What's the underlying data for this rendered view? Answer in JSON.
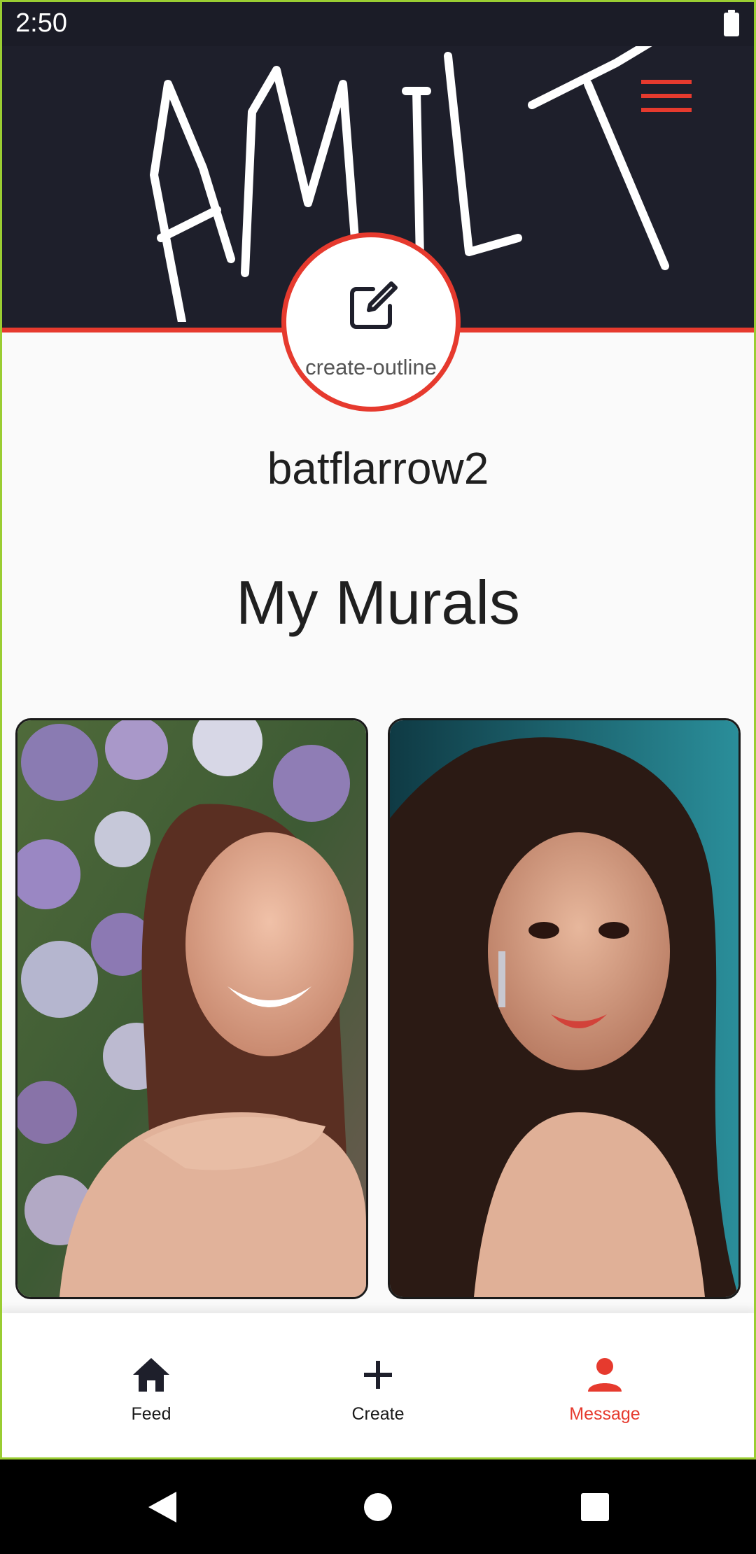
{
  "status_bar": {
    "time": "2:50",
    "battery_icon": "battery-full-icon"
  },
  "header": {
    "signature_text": "AMIT",
    "menu_icon": "hamburger-menu-icon",
    "accent_color": "#e63a2e",
    "background_color": "#1e1f2b"
  },
  "profile": {
    "edit_icon": "create-outline-icon",
    "edit_label": "create-outline",
    "username": "batflarrow2"
  },
  "murals": {
    "title": "My Murals",
    "items": [
      {
        "description_icon": "mural-thumbnail-1"
      },
      {
        "description_icon": "mural-thumbnail-2"
      }
    ]
  },
  "bottom_nav": {
    "items": [
      {
        "label": "Feed",
        "icon": "home-icon",
        "active": false
      },
      {
        "label": "Create",
        "icon": "plus-icon",
        "active": false
      },
      {
        "label": "Message",
        "icon": "person-icon",
        "active": true
      }
    ],
    "active_color": "#e63a2e"
  },
  "system_nav": {
    "back": "back-icon",
    "home": "home-circle-icon",
    "recents": "recents-icon"
  }
}
